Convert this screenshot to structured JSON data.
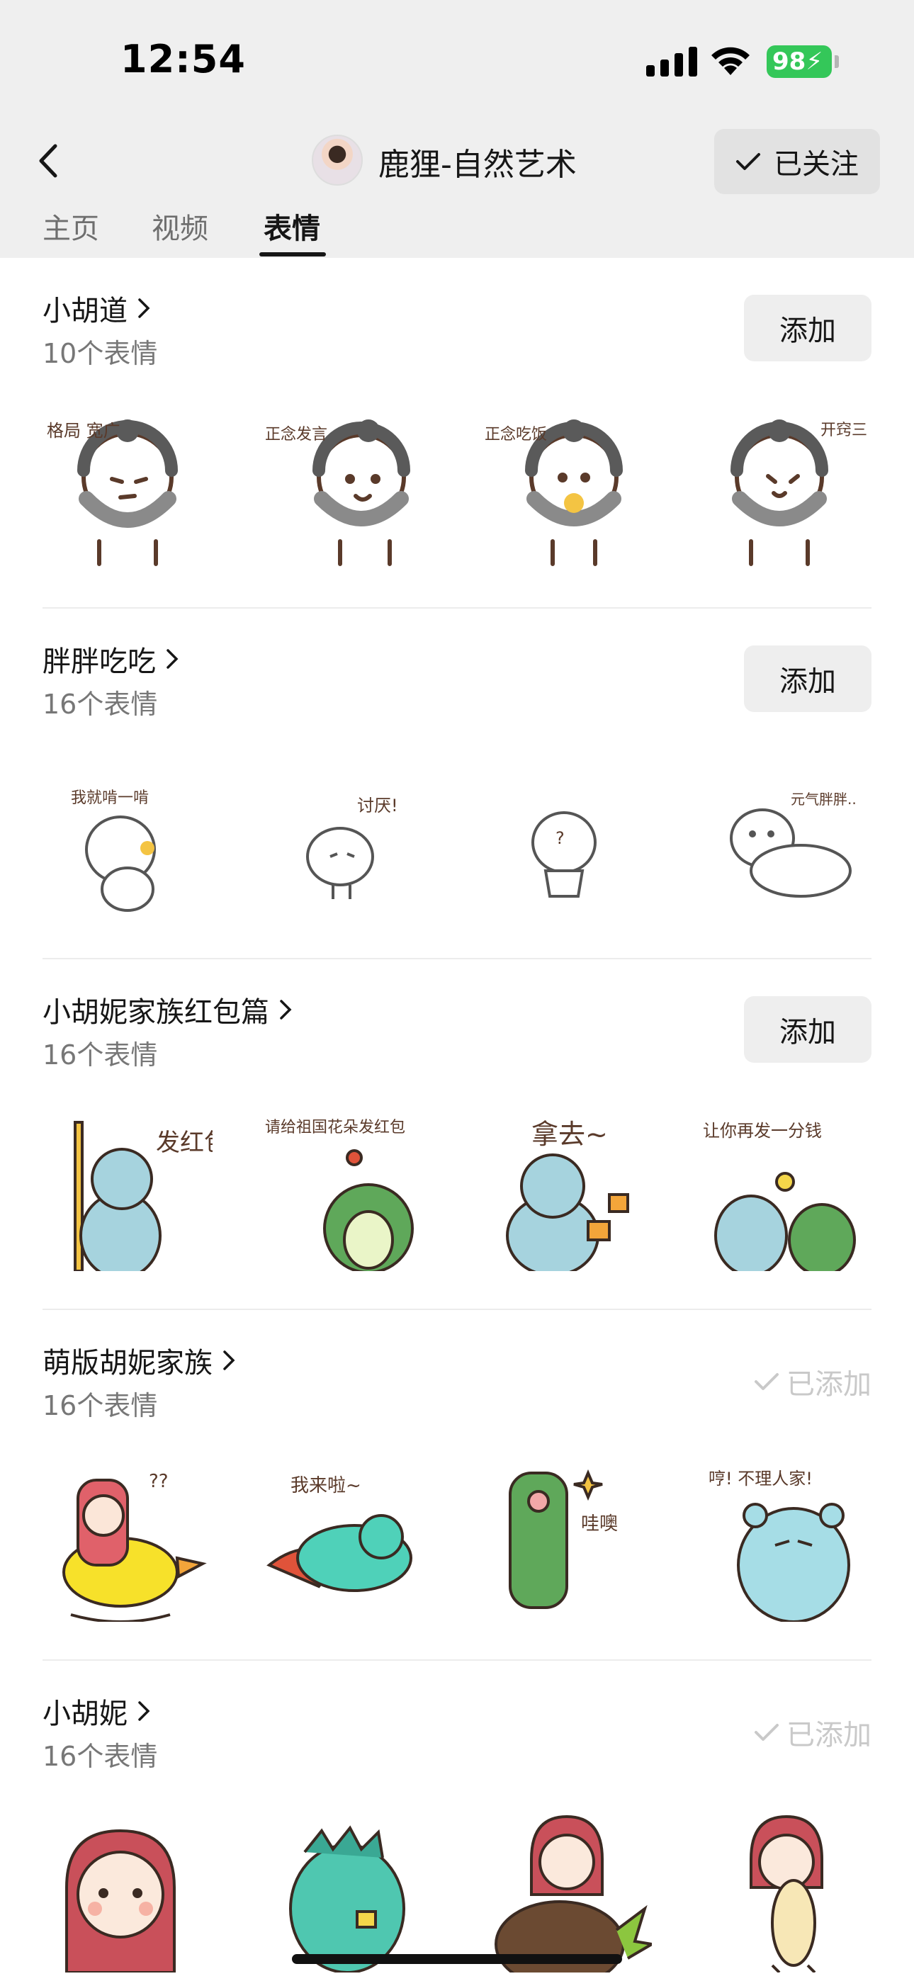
{
  "status": {
    "time": "12:54",
    "battery": "98"
  },
  "header": {
    "profile_name": "鹿狸-自然艺术",
    "follow_label": "已关注"
  },
  "tabs": [
    {
      "label": "主页"
    },
    {
      "label": "视频"
    },
    {
      "label": "表情"
    }
  ],
  "packs": [
    {
      "title": "小胡道",
      "count": "10个表情",
      "action": "添加",
      "stickers": [
        {
          "caption": "格局 宽广"
        },
        {
          "caption": "正念发言"
        },
        {
          "caption": "正念吃饭"
        },
        {
          "caption": "开窍三"
        }
      ]
    },
    {
      "title": "胖胖吃吃",
      "count": "16个表情",
      "action": "添加",
      "stickers": [
        {
          "caption": "我就啃一啃"
        },
        {
          "caption": "讨厌!"
        },
        {
          "caption": "?"
        },
        {
          "caption": "元气胖胖.."
        }
      ]
    },
    {
      "title": "小胡妮家族红包篇",
      "count": "16个表情",
      "action": "添加",
      "stickers": [
        {
          "caption": "发红包"
        },
        {
          "caption": "请给祖国花朵发红包"
        },
        {
          "caption": "拿去~"
        },
        {
          "caption": "让你再发一分钱"
        }
      ]
    },
    {
      "title": "萌版胡妮家族",
      "count": "16个表情",
      "action": "已添加",
      "stickers": [
        {
          "caption": "??"
        },
        {
          "caption": "我来啦~"
        },
        {
          "caption": "哇噢"
        },
        {
          "caption": "哼! 不理人家!"
        }
      ]
    },
    {
      "title": "小胡妮",
      "count": "16个表情",
      "action": "已添加",
      "stickers": [
        {
          "caption": ""
        },
        {
          "caption": ""
        },
        {
          "caption": ""
        },
        {
          "caption": ""
        }
      ]
    }
  ]
}
